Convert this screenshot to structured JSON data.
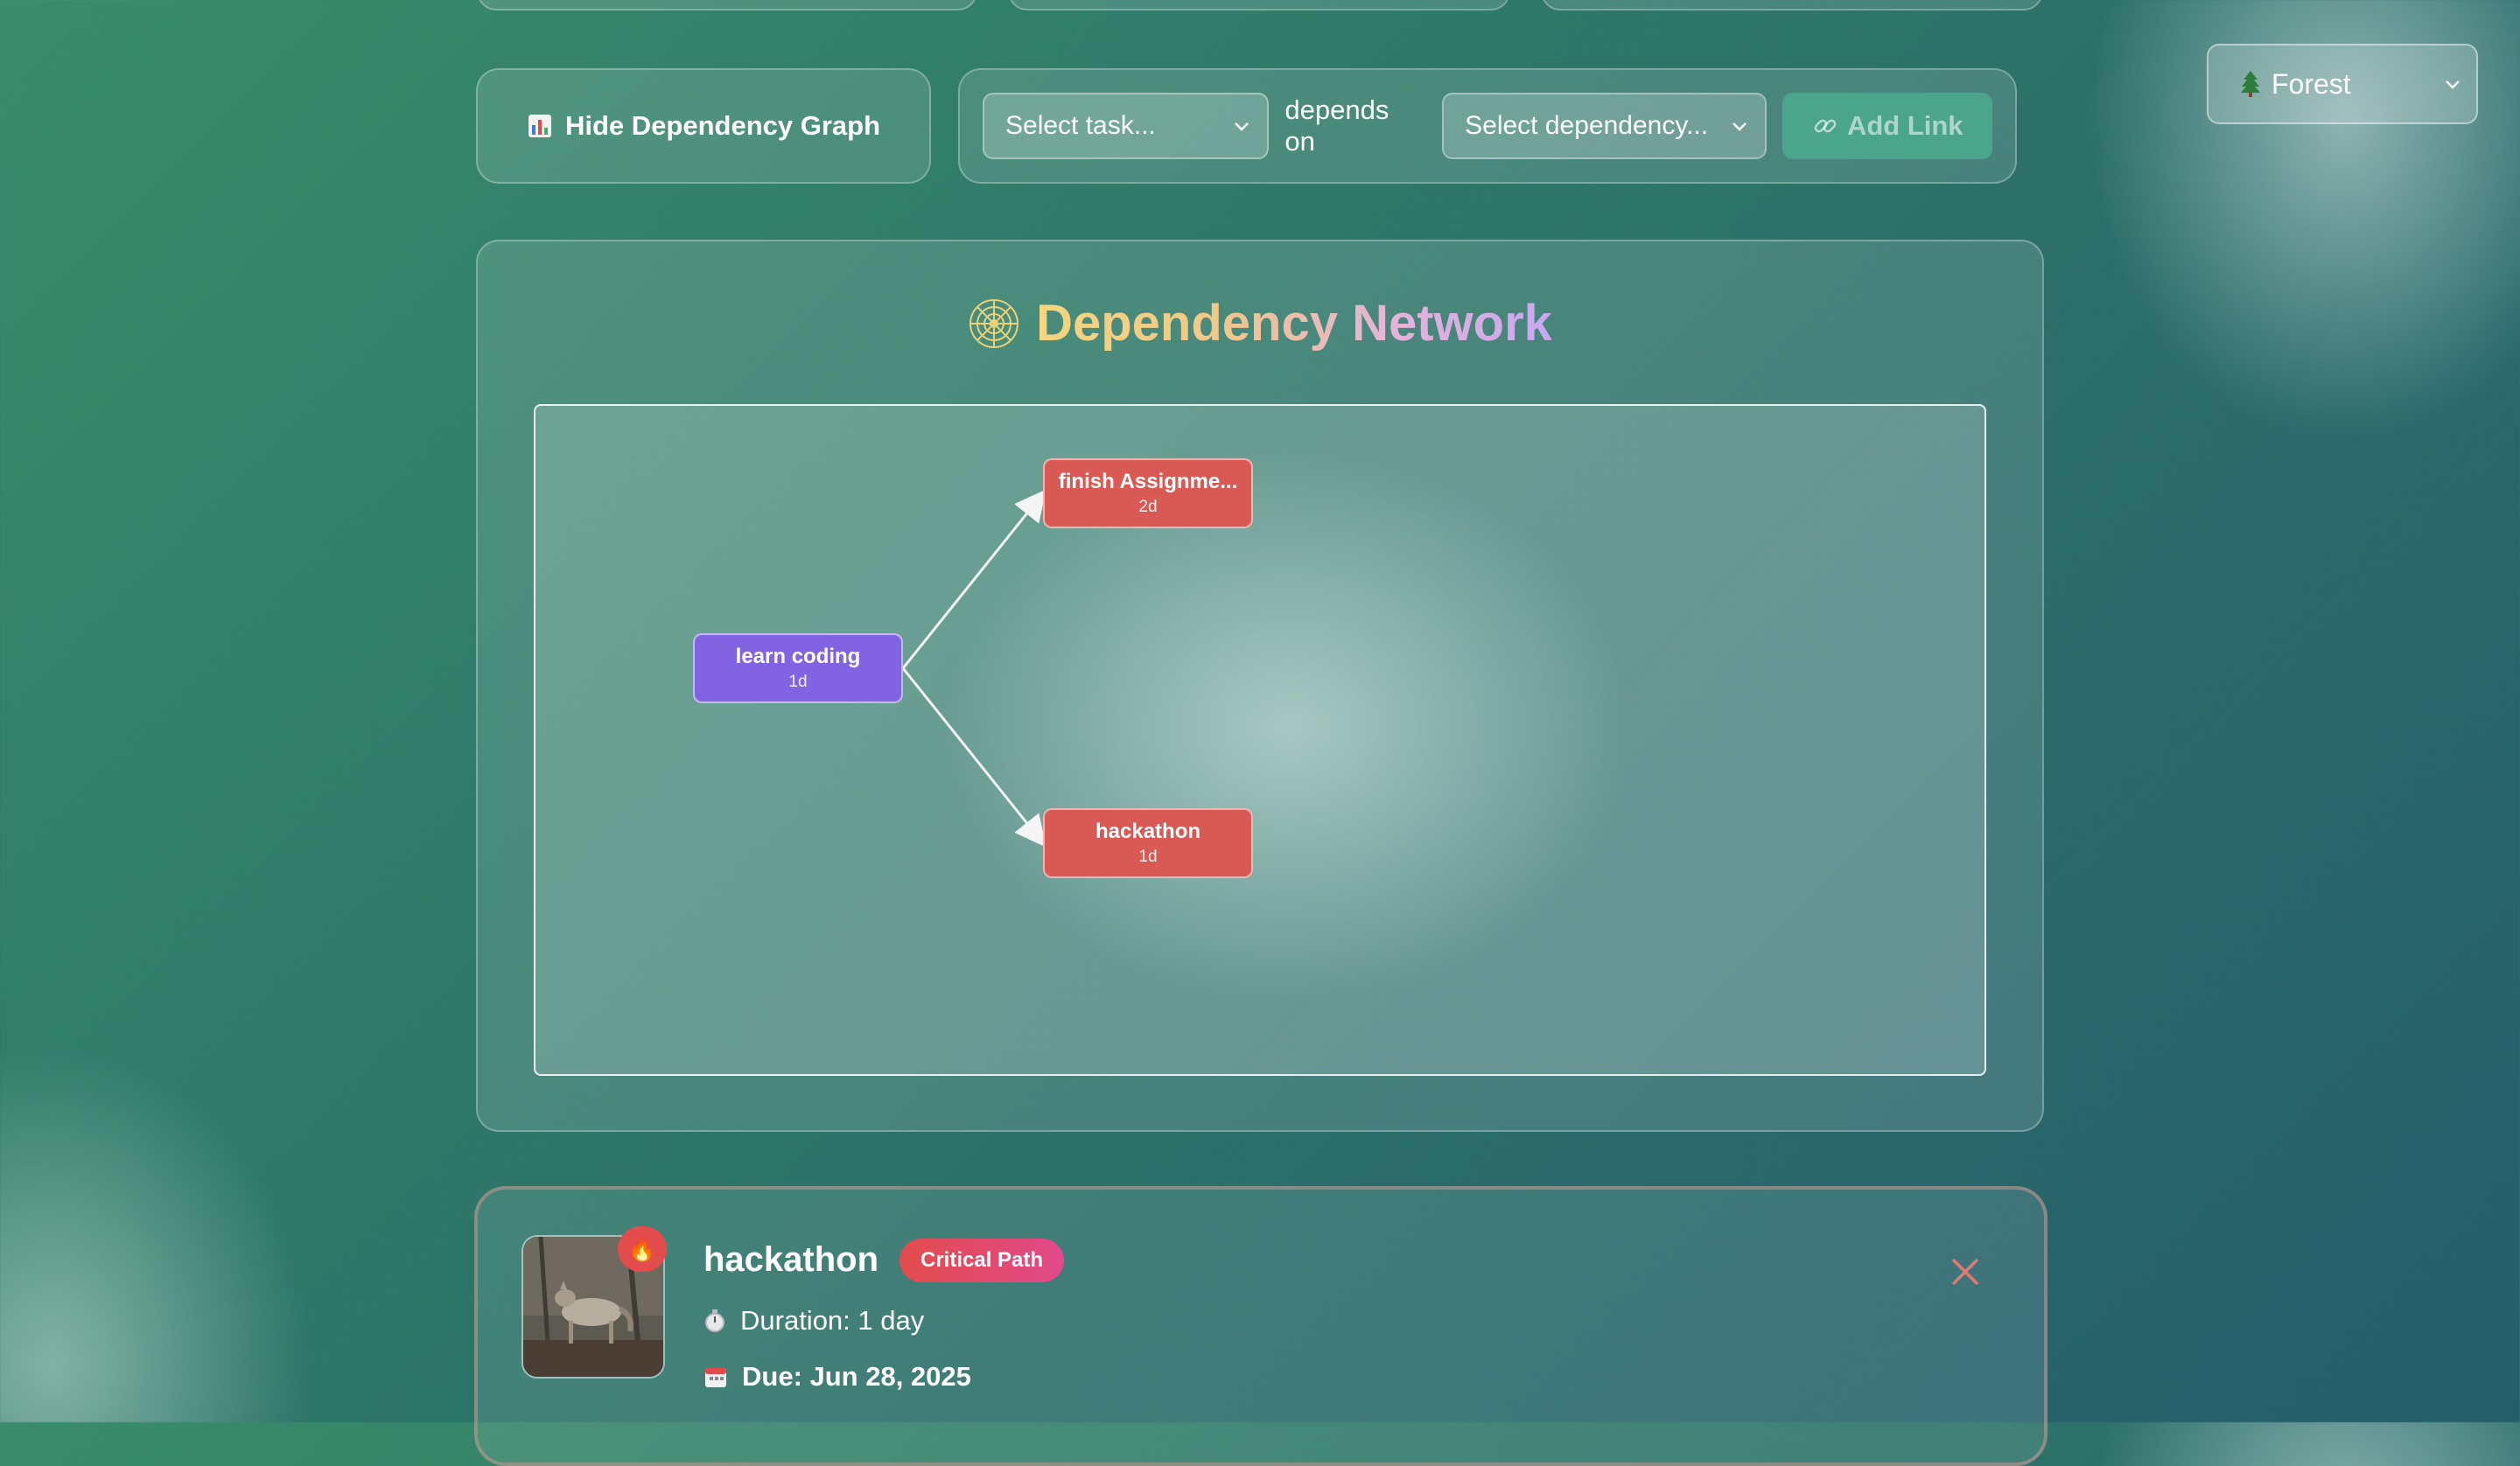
{
  "toolbar": {
    "toggle_graph_label": "Hide Dependency Graph",
    "toggle_graph_icon": "bar-chart-icon",
    "task_select_placeholder": "Select task...",
    "depends_on_label": "depends on",
    "dependency_select_placeholder": "Select dependency...",
    "add_link_label": "Add Link",
    "add_link_icon": "link-icon"
  },
  "theme": {
    "selected": "Forest",
    "icon": "tree-icon"
  },
  "graph": {
    "title": "Dependency Network",
    "title_icon": "web-icon",
    "nodes": [
      {
        "id": "learn",
        "name": "learn coding",
        "duration": "1d",
        "color": "#8264e3"
      },
      {
        "id": "finish",
        "name": "finish Assignme...",
        "duration": "2d",
        "color": "#d95a55"
      },
      {
        "id": "hack",
        "name": "hackathon",
        "duration": "1d",
        "color": "#d95a55"
      }
    ],
    "edges": [
      {
        "from": "learn",
        "to": "finish"
      },
      {
        "from": "learn",
        "to": "hack"
      }
    ]
  },
  "task_card": {
    "name": "hackathon",
    "badge": "Critical Path",
    "badge_icon": "fire-icon",
    "duration_text": "Duration: 1 day",
    "duration_icon": "stopwatch-icon",
    "due_text": "Due: Jun 28, 2025",
    "due_icon": "calendar-icon",
    "close_icon": "close-icon",
    "thumbnail": "coyote-photo",
    "colors": {
      "critical": "#e24c4c",
      "accent": "#e14a8a"
    }
  }
}
